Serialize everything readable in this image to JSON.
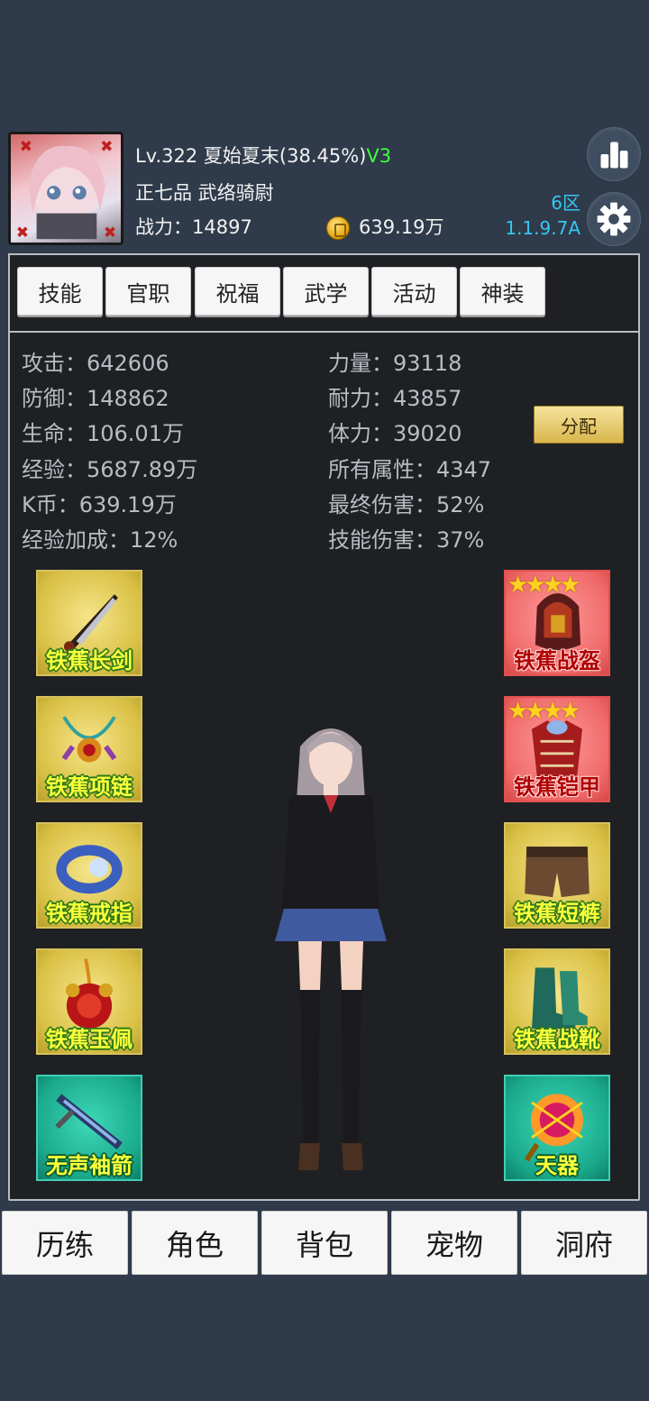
{
  "player": {
    "level_line_prefix": "Lv.322 夏始夏末(38.45%)",
    "vip": "V3",
    "rank_title": "正七品 武络骑尉",
    "power": "战力：14897",
    "coins": "639.19万",
    "zone": "6区",
    "version": "1.1.9.7A"
  },
  "tabs": [
    "技能",
    "官职",
    "祝福",
    "武学",
    "活动",
    "神装"
  ],
  "stats_left": [
    "攻击：642606",
    "防御：148862",
    "生命：106.01万",
    "经验：5687.89万",
    "K币：639.19万",
    "经验加成：12%"
  ],
  "stats_right": [
    "力量：93118",
    "耐力：43857",
    "体力：39020",
    "所有属性：4347",
    "最终伤害：52%",
    "技能伤害：37%"
  ],
  "allocate_label": "分配",
  "equipment_left": [
    {
      "label": "铁蕉长剑",
      "icon": "sword-icon"
    },
    {
      "label": "铁蕉项链",
      "icon": "necklace-icon"
    },
    {
      "label": "铁蕉戒指",
      "icon": "ring-icon"
    },
    {
      "label": "铁蕉玉佩",
      "icon": "jade-pendant-icon"
    },
    {
      "label": "无声袖箭",
      "icon": "sleeve-arrow-icon"
    }
  ],
  "equipment_right": [
    {
      "label": "铁蕉战盔",
      "icon": "helmet-icon",
      "stars": "★★★★"
    },
    {
      "label": "铁蕉铠甲",
      "icon": "armor-icon",
      "stars": "★★★★"
    },
    {
      "label": "铁蕉短裤",
      "icon": "shorts-icon"
    },
    {
      "label": "铁蕉战靴",
      "icon": "boots-icon"
    },
    {
      "label": "天器",
      "icon": "divine-artifact-icon"
    }
  ],
  "bottom_nav": [
    "历练",
    "角色",
    "背包",
    "宠物",
    "洞府"
  ],
  "colors": {
    "background": "#2f3a4a",
    "panel": "#1e2024",
    "vip": "#3cff3c",
    "version": "#36c8f0"
  }
}
